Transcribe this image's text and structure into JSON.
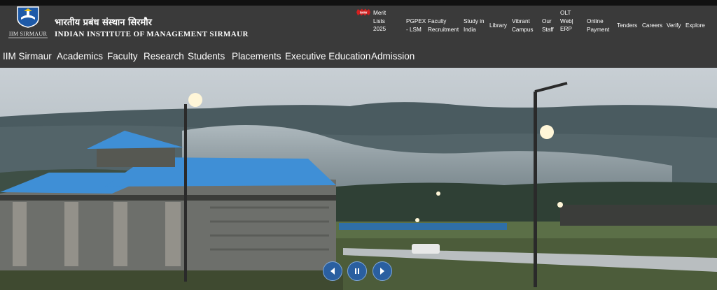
{
  "header": {
    "logo_text": "IIM SIRMAUR",
    "title_hindi": "भारतीय प्रबंध संस्थान सिरमौर",
    "title_english": "INDIAN INSTITUTE OF MANAGEMENT SIRMAUR"
  },
  "utility_nav": {
    "new_badge": "new",
    "items": [
      {
        "line1": "Merit",
        "line2": "Lists",
        "line3": "2025"
      },
      {
        "line1": "PGPEX",
        "line2": "- LSM",
        "line3": ""
      },
      {
        "line1": "Faculty",
        "line2": "Recruitment",
        "line3": ""
      },
      {
        "line1": "Study in",
        "line2": "India",
        "line3": ""
      },
      {
        "line1": "Library",
        "line2": "",
        "line3": ""
      },
      {
        "line1": "Vibrant",
        "line2": "Campus",
        "line3": ""
      },
      {
        "line1": "Our",
        "line2": "Staff",
        "line3": ""
      },
      {
        "line1": "OLT",
        "line2": "Web|",
        "line3": "ERP"
      },
      {
        "line1": "Online",
        "line2": "Payment",
        "line3": ""
      },
      {
        "line1": "Tenders",
        "line2": "",
        "line3": ""
      },
      {
        "line1": "Careers",
        "line2": "",
        "line3": ""
      },
      {
        "line1": "Verify",
        "line2": "",
        "line3": ""
      },
      {
        "line1": "Explore",
        "line2": "",
        "line3": ""
      }
    ]
  },
  "main_nav": {
    "items": [
      "IIM Sirmaur",
      "Academics",
      "Faculty",
      "Research",
      "Students",
      "Placements",
      "Executive Education",
      "Admission"
    ]
  },
  "hero": {
    "image": "campus-building-misty-mountains",
    "controls": [
      "previous-icon",
      "pause-icon",
      "next-icon"
    ]
  },
  "colors": {
    "header_bg": "#3a3a3a",
    "roof_blue": "#3f8fd6",
    "control_blue": "#2a5fa0"
  }
}
